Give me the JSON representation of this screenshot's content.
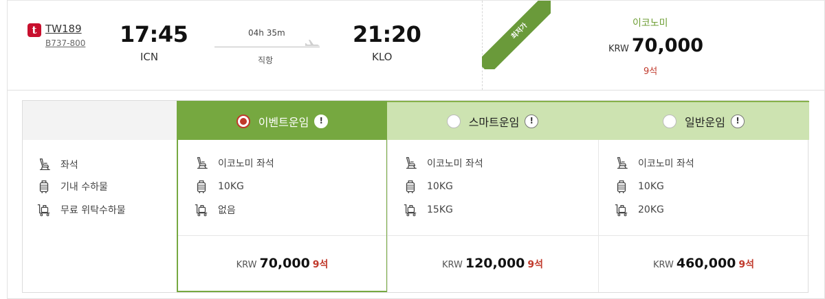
{
  "flight": {
    "logo_letter": "t",
    "number": "TW189",
    "aircraft": "B737-800",
    "departure": {
      "time": "17:45",
      "code": "ICN"
    },
    "arrival": {
      "time": "21:20",
      "code": "KLO"
    },
    "duration": "04h 35m",
    "stop_type": "직항"
  },
  "best_price": {
    "ribbon": "최저가",
    "fare_class": "이코노미",
    "currency": "KRW",
    "price": "70,000",
    "seats": "9석"
  },
  "row_labels": [
    "좌석",
    "기내 수하물",
    "무료 위탁수하물"
  ],
  "fares": [
    {
      "name": "이벤트운임",
      "selected": true,
      "info": "!",
      "seat": "이코노미 좌석",
      "carry_on": "10KG",
      "checked": "없음",
      "currency": "KRW",
      "price": "70,000",
      "seats": "9석"
    },
    {
      "name": "스마트운임",
      "selected": false,
      "info": "!",
      "seat": "이코노미 좌석",
      "carry_on": "10KG",
      "checked": "15KG",
      "currency": "KRW",
      "price": "120,000",
      "seats": "9석"
    },
    {
      "name": "일반운임",
      "selected": false,
      "info": "!",
      "seat": "이코노미 좌석",
      "carry_on": "10KG",
      "checked": "20KG",
      "currency": "KRW",
      "price": "460,000",
      "seats": "9석"
    }
  ],
  "colors": {
    "accent_green": "#76a840",
    "light_green": "#cde3b1",
    "seat_red": "#c0392b",
    "brand_red": "#c8102e"
  }
}
